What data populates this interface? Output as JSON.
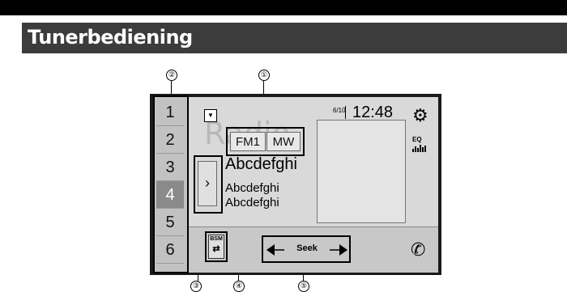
{
  "header": {
    "title": "Tunerbediening"
  },
  "callouts": [
    "①",
    "②",
    "③",
    "④",
    "⑤"
  ],
  "screen": {
    "presets": [
      "1",
      "2",
      "3",
      "4",
      "5",
      "6"
    ],
    "active_preset": "4",
    "dropdown_icon": "▼",
    "ghost_text": "Radio",
    "bands": [
      "FM1",
      "MW"
    ],
    "expand_icon": "›",
    "station_name": "Abcdefghi",
    "info_lines": [
      "Abcdefghi",
      "Abcdefghi"
    ],
    "preset_index": "6/10",
    "clock": "12:48",
    "settings_icon": "gear-icon",
    "eq_label": "EQ",
    "bsm_label": "BSM",
    "bsm_icon": "⇄",
    "seek_label": "Seek",
    "phone_icon": "phone-icon",
    "colors": {
      "active_preset_bg": "#8a8a8a",
      "header_bg": "#3c3c3c"
    }
  }
}
